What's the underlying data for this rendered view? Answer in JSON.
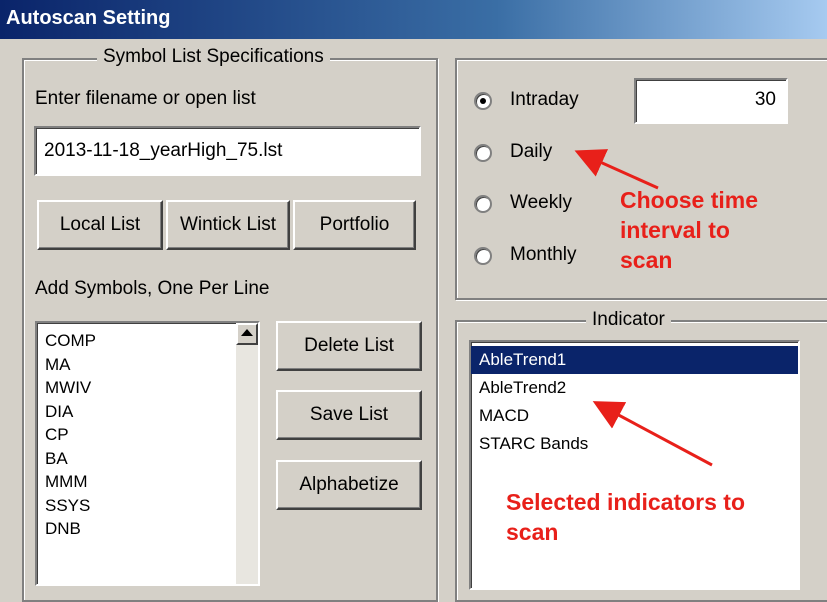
{
  "window": {
    "title": "Autoscan Setting"
  },
  "symbol_group": {
    "legend": "Symbol List Specifications",
    "filename_label": "Enter filename or open list",
    "filename_value": "2013-11-18_yearHigh_75.lst",
    "buttons": {
      "local_list": "Local List",
      "wintick_list": "Wintick List",
      "portfolio": "Portfolio"
    },
    "add_symbols_label": "Add Symbols, One Per Line",
    "symbols": [
      "COMP",
      "MA",
      "MWIV",
      "DIA",
      "CP",
      "BA",
      "MMM",
      "SSYS",
      "DNB"
    ],
    "side_buttons": {
      "delete_list": "Delete List",
      "save_list": "Save List",
      "alphabetize": "Alphabetize"
    }
  },
  "interval_group": {
    "options": [
      {
        "label": "Intraday",
        "selected": true
      },
      {
        "label": "Daily",
        "selected": false
      },
      {
        "label": "Weekly",
        "selected": false
      },
      {
        "label": "Monthly",
        "selected": false
      }
    ],
    "intraday_value": "30"
  },
  "indicator_group": {
    "legend": "Indicator",
    "items": [
      {
        "label": "AbleTrend1",
        "selected": true
      },
      {
        "label": "AbleTrend2",
        "selected": false
      },
      {
        "label": "MACD",
        "selected": false
      },
      {
        "label": "STARC Bands",
        "selected": false
      }
    ]
  },
  "annotations": {
    "time_interval": [
      "Choose time",
      "interval to",
      "scan"
    ],
    "indicators": [
      "Selected indicators to",
      "scan"
    ]
  },
  "colors": {
    "title_bar": "#0a246a",
    "annotation": "#e8201a",
    "selection": "#0a246a"
  }
}
